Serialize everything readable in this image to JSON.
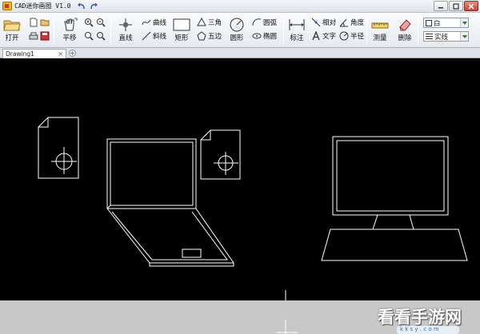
{
  "window": {
    "title": "CAD迷你画图 V1.0",
    "controls": [
      "minimize",
      "maximize",
      "close"
    ]
  },
  "ribbon": {
    "file_open": "打开",
    "pan": "平移",
    "line": "直线",
    "curve": "曲线",
    "oblique_line": "斜线",
    "rectangle": "矩形",
    "triangle": "三角",
    "pentagon": "五边",
    "circle": "圆形",
    "arc": "圆弧",
    "ellipse": "椭圆",
    "dimension": "标注",
    "relative": "相对",
    "angle": "角度",
    "text": "文字",
    "radius": "半径",
    "measure": "测量",
    "erase": "删除",
    "color_value": "白",
    "linetype_value": "实线"
  },
  "tabs": [
    {
      "label": "Drawing1"
    }
  ],
  "watermark": {
    "text": "看看手游网",
    "sub": "k k s y . c o m"
  },
  "colors": {
    "canvas": "#000000",
    "stroke": "#ffffff",
    "ribbon_top": "#fafbfc",
    "ribbon_bottom": "#e6eaef"
  }
}
